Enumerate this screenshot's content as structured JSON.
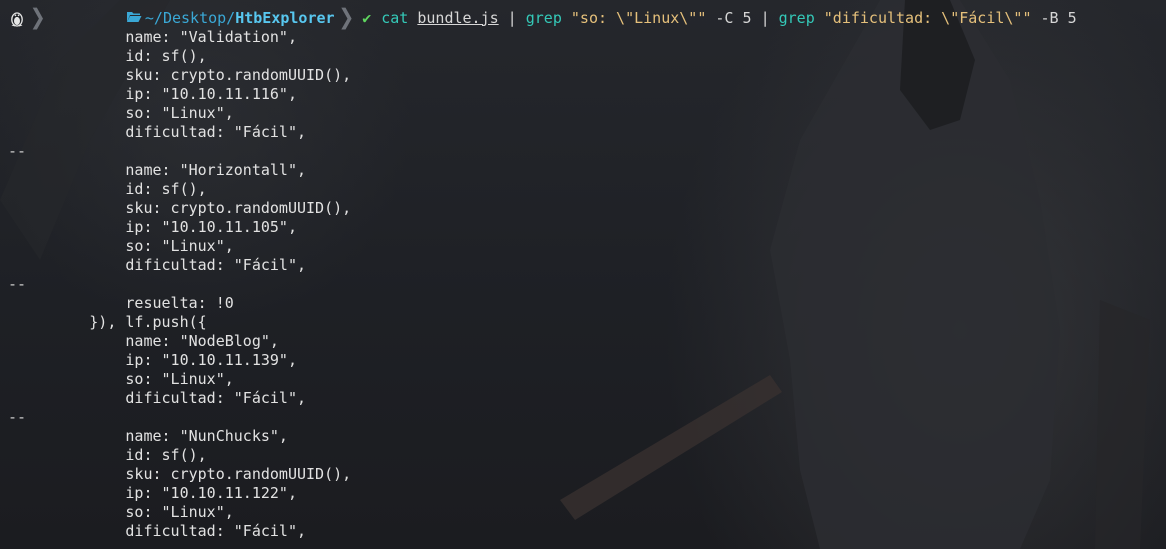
{
  "prompt": {
    "os_icon": "tux-icon",
    "path_prefix": "~/Desktop/",
    "path_leaf": "HtbExplorer",
    "status_icon": "check-icon",
    "status_glyph": "✔"
  },
  "command": {
    "c1": "cat",
    "file": "bundle.js",
    "p1": " | ",
    "grep1": "grep",
    "q1": "\"so: \\\"Linux\\\"\"",
    "opt1": " -C 5 ",
    "p2": "| ",
    "grep2": "grep",
    "q2": "\"dificultad: \\\"Fácil\\\"\"",
    "opt2": " -B 5"
  },
  "output_lines": [
    "             name: \"Validation\",",
    "             id: sf(),",
    "             sku: crypto.randomUUID(),",
    "             ip: \"10.10.11.116\",",
    "             so: \"Linux\",",
    "             dificultad: \"Fácil\",",
    "--",
    "             name: \"Horizontall\",",
    "             id: sf(),",
    "             sku: crypto.randomUUID(),",
    "             ip: \"10.10.11.105\",",
    "             so: \"Linux\",",
    "             dificultad: \"Fácil\",",
    "--",
    "             resuelta: !0",
    "         }), lf.push({",
    "             name: \"NodeBlog\",",
    "             ip: \"10.10.11.139\",",
    "             so: \"Linux\",",
    "             dificultad: \"Fácil\",",
    "--",
    "             name: \"NunChucks\",",
    "             id: sf(),",
    "             sku: crypto.randomUUID(),",
    "             ip: \"10.10.11.122\",",
    "             so: \"Linux\",",
    "             dificultad: \"Fácil\","
  ],
  "colors": {
    "background": "#1f2126",
    "directory": "#3aa8d6",
    "command_keyword": "#34c9b8",
    "string_literal": "#e5c07b",
    "status_ok": "#5fd75f"
  }
}
